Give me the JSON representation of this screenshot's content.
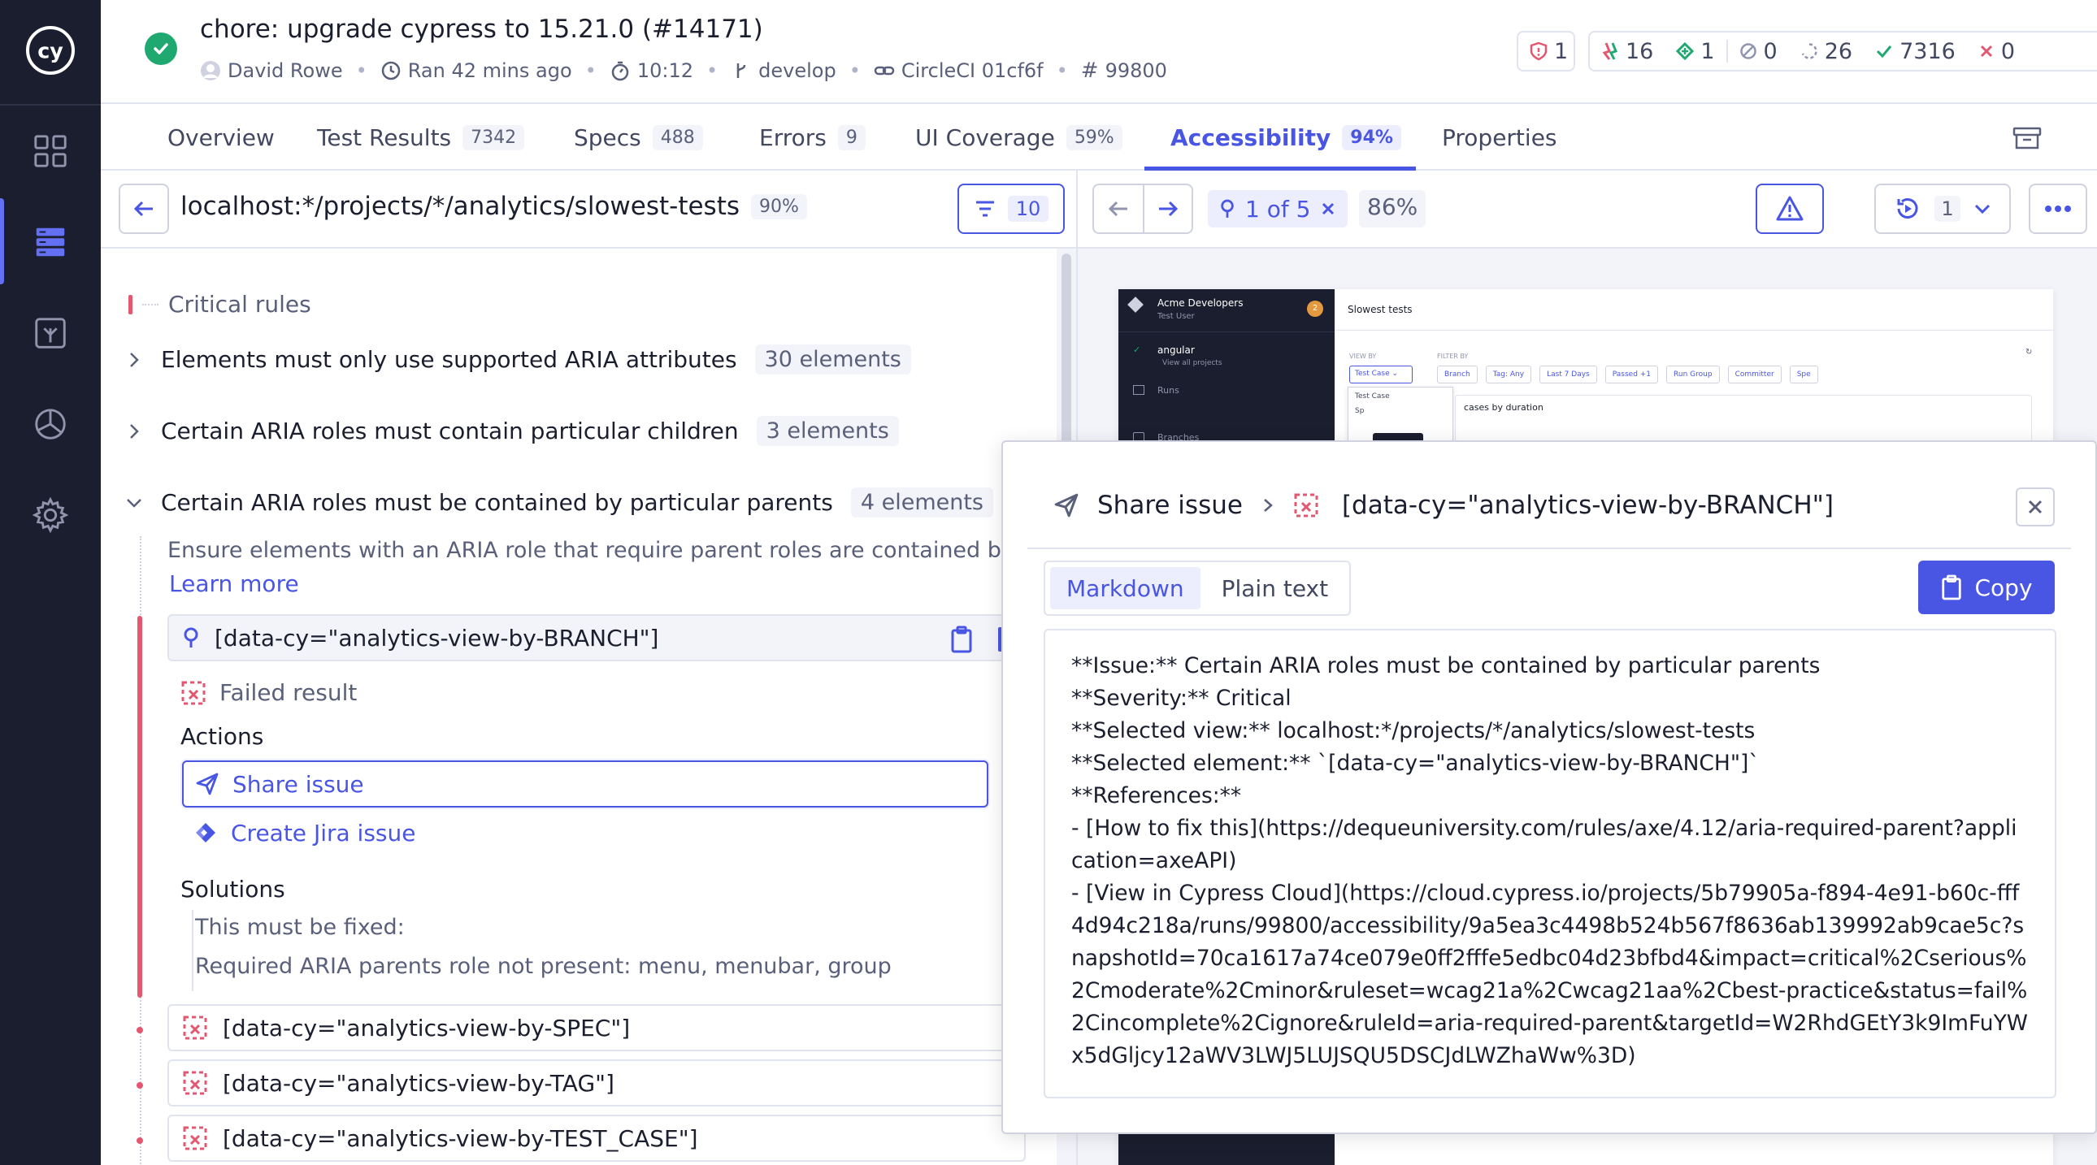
{
  "header": {
    "title": "chore: upgrade cypress to 15.21.0 (#14171)",
    "author": "David Rowe",
    "ran": "Ran 42 mins ago",
    "duration": "10:12",
    "branch": "develop",
    "ci": "CircleCI 01cf6f",
    "run_number": "99800",
    "stats": {
      "accessibility_violations": "1",
      "flaky": "16",
      "new": "1",
      "skipped": "0",
      "pending": "26",
      "passed": "7316",
      "failed": "0"
    }
  },
  "tabs": [
    {
      "label": "Overview",
      "count": ""
    },
    {
      "label": "Test Results",
      "count": "7342"
    },
    {
      "label": "Specs",
      "count": "488"
    },
    {
      "label": "Errors",
      "count": "9"
    },
    {
      "label": "UI Coverage",
      "count": "59%"
    },
    {
      "label": "Accessibility",
      "count": "94%"
    },
    {
      "label": "Properties",
      "count": ""
    }
  ],
  "left": {
    "url": "localhost:*/projects/*/analytics/slowest-tests",
    "url_score": "90%",
    "filter_count": "10",
    "section_label": "Critical rules",
    "rules": [
      {
        "label": "Elements must only use supported ARIA attributes",
        "count": "30 elements"
      },
      {
        "label": "Certain ARIA roles must contain particular children",
        "count": "3 elements"
      },
      {
        "label": "Certain ARIA roles must be contained by particular parents",
        "count": "4 elements"
      }
    ],
    "rule_description": "Ensure elements with an ARIA role that require parent roles are contained by them",
    "learn_more": "Learn more",
    "selected_element": "[data-cy=\"analytics-view-by-BRANCH\"]",
    "failed_result": "Failed result",
    "actions_label": "Actions",
    "share_issue": "Share issue",
    "create_jira": "Create Jira issue",
    "solutions_label": "Solutions",
    "solution_must": "This must be fixed:",
    "solution_detail": "Required ARIA parents role not present: menu, menubar, group",
    "other_elements": [
      "[data-cy=\"analytics-view-by-SPEC\"]",
      "[data-cy=\"analytics-view-by-TAG\"]",
      "[data-cy=\"analytics-view-by-TEST_CASE\"]"
    ]
  },
  "right": {
    "pager": "1 of 5",
    "score": "86%",
    "replay_count": "1",
    "snapshot": {
      "org": "Acme Developers",
      "user": "Test User",
      "project": "angular",
      "view_all": "View all projects",
      "nav_runs": "Runs",
      "nav_branches": "Branches",
      "page_title": "Slowest tests",
      "view_by": "VIEW BY",
      "filter_by": "FILTER BY",
      "test_case": "Test Case",
      "filters": [
        "Branch",
        "Tag: Any",
        "Last 7 Days",
        "Passed +1",
        "Run Group",
        "Committer",
        "Spe"
      ],
      "dropdown_item": "Test Case",
      "dropdown_item2": "Sp",
      "cases_label": "cases by duration",
      "badge": "2"
    }
  },
  "modal": {
    "title": "Share issue",
    "element": "[data-cy=\"analytics-view-by-BRANCH\"]",
    "tab_markdown": "Markdown",
    "tab_plain": "Plain text",
    "copy": "Copy",
    "content": "**Issue:** Certain ARIA roles must be contained by particular parents\n**Severity:** Critical\n**Selected view:** localhost:*/projects/*/analytics/slowest-tests\n**Selected element:** `[data-cy=\"analytics-view-by-BRANCH\"]`\n**References:**\n- [How to fix this](https://dequeuniversity.com/rules/axe/4.12/aria-required-parent?application=axeAPI)\n- [View in Cypress Cloud](https://cloud.cypress.io/projects/5b79905a-f894-4e91-b60c-fff4d94c218a/runs/99800/accessibility/9a5ea3c4498b524b567f8636ab139992ab9cae5c?snapshotId=70ca1617a74ce079e0ff2fffe5edbc04d23bfbd4&impact=critical%2Cserious%2Cmoderate%2Cminor&ruleset=wcag21a%2Cwcag21aa%2Cbest-practice&status=fail%2Cincomplete%2Cignore&ruleId=aria-required-parent&targetId=W2RhdGEtY3k9ImFuYWx5dGljcy12aWV3LWJ5LUJSQU5DSCJdLWZhaWw%3D)"
  },
  "colors": {
    "sidebar": "#1b1e2e",
    "accent": "#4956e3",
    "critical": "#e45770",
    "success": "#1fa971"
  }
}
